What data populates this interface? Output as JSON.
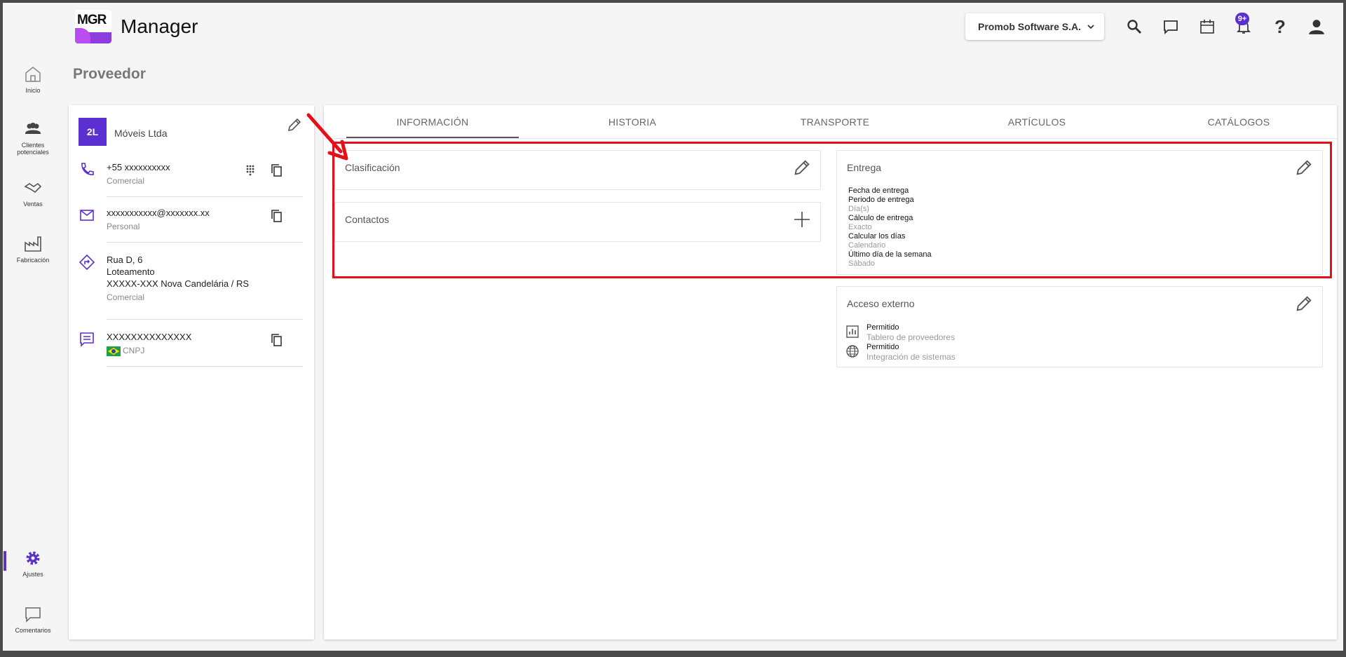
{
  "app": {
    "logo_text": "MGR",
    "title": "Manager"
  },
  "header": {
    "company": "Promob Software S.A.",
    "notifications_badge": "9+",
    "icons": [
      "search-icon",
      "chat-icon",
      "calendar-icon",
      "bell-icon",
      "help-icon",
      "account-icon"
    ]
  },
  "nav": {
    "items": [
      {
        "label": "Inicio",
        "icon": "home-icon"
      },
      {
        "label": "Clientes potenciales",
        "icon": "people-icon"
      },
      {
        "label": "Ventas",
        "icon": "handshake-icon"
      },
      {
        "label": "Fabricación",
        "icon": "factory-icon"
      },
      {
        "label": "Ajustes",
        "icon": "gear-icon",
        "active": true
      },
      {
        "label": "Comentarios",
        "icon": "comment-icon"
      }
    ],
    "accent": "#5b2fd0"
  },
  "page": {
    "title": "Proveedor"
  },
  "supplier": {
    "initials": "2L",
    "name": "Móveis Ltda",
    "phone": "+55 xxxxxxxxxx",
    "phone_type": "Comercial",
    "email": "xxxxxxxxxxx@xxxxxxx.xx",
    "email_type": "Personal",
    "address_line1": "Rua D, 6",
    "address_line2": "Loteamento",
    "address_line3": "XXXXX-XXX Nova Candelária / RS",
    "address_type": "Comercial",
    "document": "XXXXXXXXXXXXXX",
    "document_type": "CNPJ"
  },
  "tabs": [
    "INFORMACIÓN",
    "HISTORIA",
    "TRANSPORTE",
    "ARTÍCULOS",
    "CATÁLOGOS"
  ],
  "cards": {
    "clasificacion": {
      "title": "Clasificación"
    },
    "contactos": {
      "title": "Contactos"
    },
    "entrega": {
      "title": "Entrega",
      "fields": [
        {
          "label": "Fecha de entrega",
          "value": ""
        },
        {
          "label": "Periodo de entrega",
          "value": "Día(s)"
        },
        {
          "label": "Cálculo de entrega",
          "value": "Exacto"
        },
        {
          "label": "Calcular los días",
          "value": "Calendario"
        },
        {
          "label": "Último día de la semana",
          "value": "Sábado"
        }
      ]
    },
    "acceso_externo": {
      "title": "Acceso externo",
      "rows": [
        {
          "status": "Permitido",
          "label": "Tablero de proveedores",
          "icon": "chart-icon"
        },
        {
          "status": "Permitido",
          "label": "Integración de sistemas",
          "icon": "globe-icon"
        }
      ]
    }
  },
  "colors": {
    "highlight": "#e3101a",
    "arrow": "#e3101a"
  }
}
